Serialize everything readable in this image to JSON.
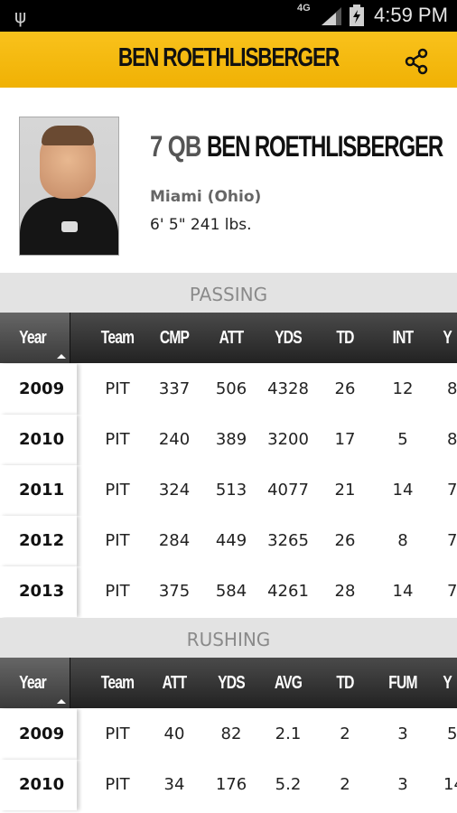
{
  "status_bar": {
    "network": "4G",
    "time": "4:59 PM"
  },
  "app_bar": {
    "title": "BEN ROETHLISBERGER"
  },
  "player": {
    "number_position": "7 QB",
    "name": "BEN ROETHLISBERGER",
    "college": "Miami (Ohio)",
    "height_weight": "6' 5\" 241 lbs."
  },
  "passing": {
    "title": "PASSING",
    "columns": [
      "Year",
      "Team",
      "CMP",
      "ATT",
      "YDS",
      "TD",
      "INT",
      "Y"
    ],
    "rows": [
      [
        "2009",
        "PIT",
        "337",
        "506",
        "4328",
        "26",
        "12",
        "8"
      ],
      [
        "2010",
        "PIT",
        "240",
        "389",
        "3200",
        "17",
        "5",
        "8"
      ],
      [
        "2011",
        "PIT",
        "324",
        "513",
        "4077",
        "21",
        "14",
        "7"
      ],
      [
        "2012",
        "PIT",
        "284",
        "449",
        "3265",
        "26",
        "8",
        "7"
      ],
      [
        "2013",
        "PIT",
        "375",
        "584",
        "4261",
        "28",
        "14",
        "7"
      ]
    ]
  },
  "rushing": {
    "title": "RUSHING",
    "columns": [
      "Year",
      "Team",
      "ATT",
      "YDS",
      "AVG",
      "TD",
      "FUM",
      "Y"
    ],
    "rows": [
      [
        "2009",
        "PIT",
        "40",
        "82",
        "2.1",
        "2",
        "3",
        "5"
      ],
      [
        "2010",
        "PIT",
        "34",
        "176",
        "5.2",
        "2",
        "3",
        "14"
      ]
    ]
  },
  "colors": {
    "accent": "#f5b90f",
    "header_dark": "#2a2a2a"
  }
}
